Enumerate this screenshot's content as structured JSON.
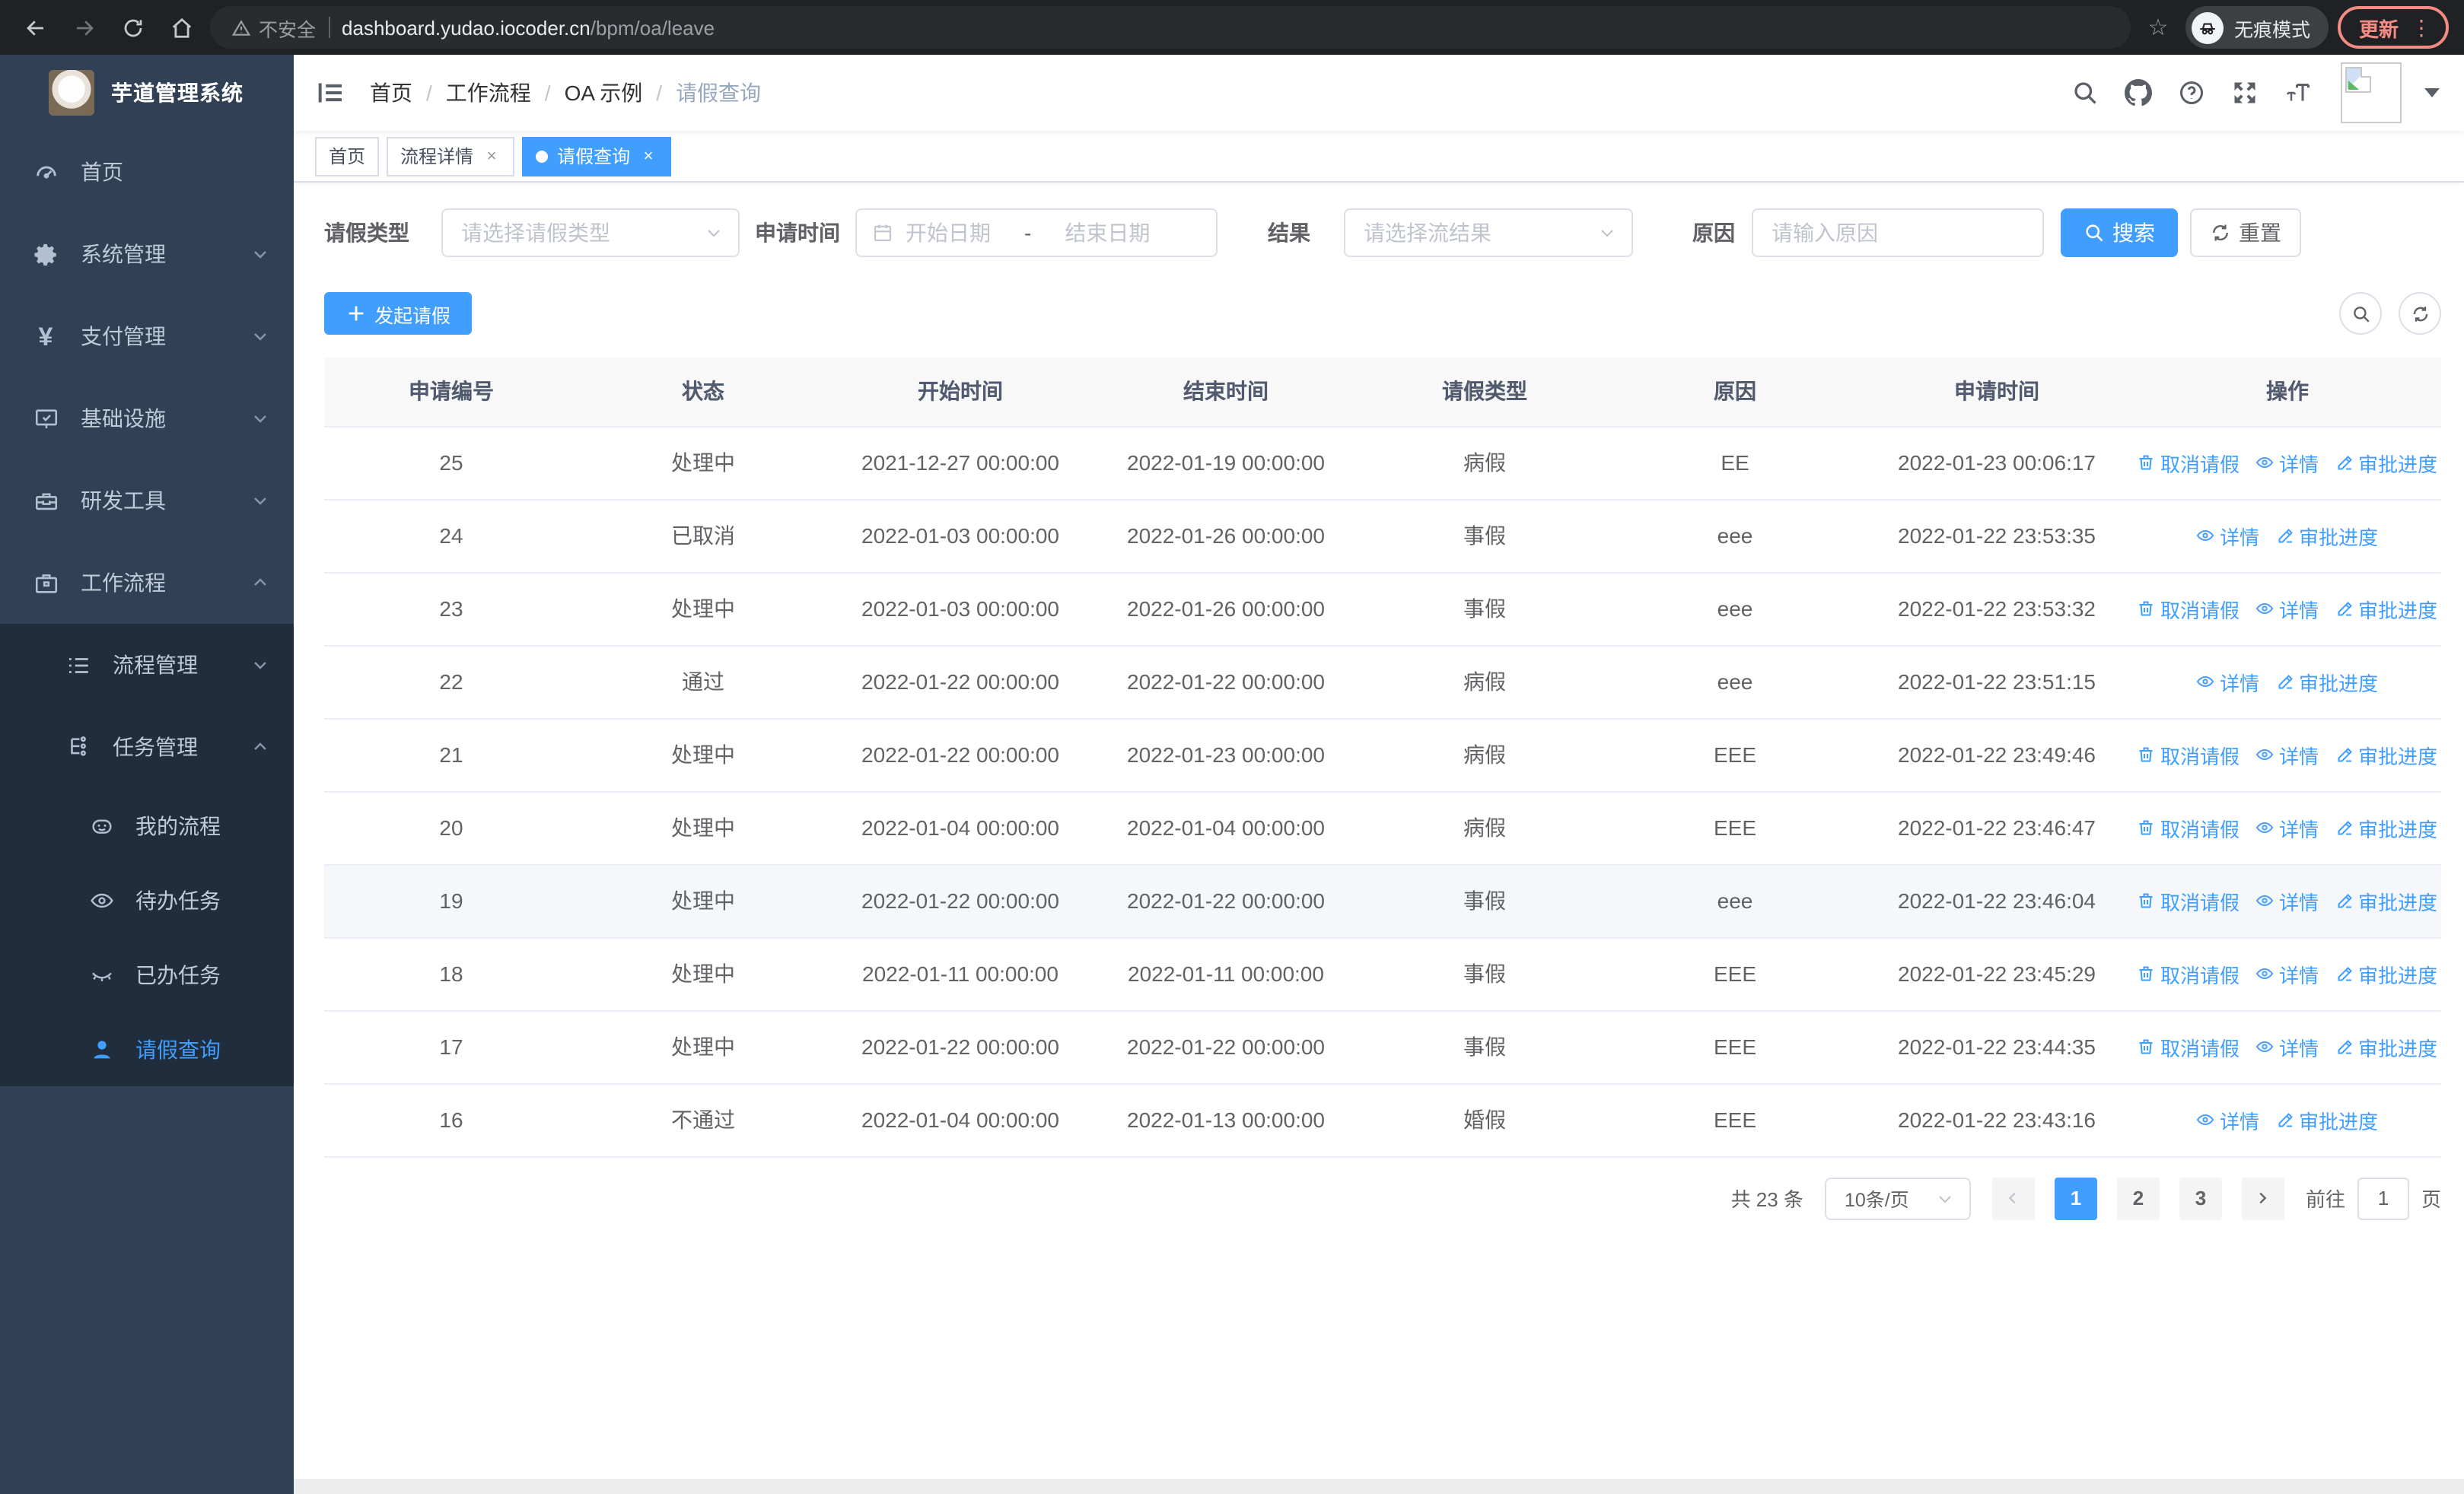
{
  "browser": {
    "security_label": "不安全",
    "url_host": "dashboard.yudao.iocoder.cn",
    "url_path": "/bpm/oa/leave",
    "incognito_label": "无痕模式",
    "update_label": "更新"
  },
  "sidebar": {
    "title": "芋道管理系统",
    "menu": [
      {
        "label": "首页"
      },
      {
        "label": "系统管理"
      },
      {
        "label": "支付管理"
      },
      {
        "label": "基础设施"
      },
      {
        "label": "研发工具"
      },
      {
        "label": "工作流程"
      }
    ],
    "submenu": [
      {
        "label": "流程管理"
      },
      {
        "label": "任务管理"
      }
    ],
    "task_items": [
      {
        "label": "我的流程"
      },
      {
        "label": "待办任务"
      },
      {
        "label": "已办任务"
      },
      {
        "label": "请假查询",
        "active": true
      }
    ],
    "yen_glyph": "¥"
  },
  "header": {
    "breadcrumb": [
      "首页",
      "工作流程",
      "OA 示例",
      "请假查询"
    ],
    "separator": "/"
  },
  "tabs": [
    {
      "label": "首页"
    },
    {
      "label": "流程详情"
    },
    {
      "label": "请假查询"
    }
  ],
  "filters": {
    "leave_type_label": "请假类型",
    "leave_type_placeholder": "请选择请假类型",
    "apply_time_label": "申请时间",
    "start_date_placeholder": "开始日期",
    "range_separator": "-",
    "end_date_placeholder": "结束日期",
    "result_label": "结果",
    "result_placeholder": "请选择流结果",
    "reason_label": "原因",
    "reason_placeholder": "请输入原因",
    "search_label": "搜索",
    "reset_label": "重置"
  },
  "toolbar": {
    "create_label": "发起请假"
  },
  "table": {
    "columns": [
      "申请编号",
      "状态",
      "开始时间",
      "结束时间",
      "请假类型",
      "原因",
      "申请时间",
      "操作"
    ],
    "action_labels": {
      "cancel": "取消请假",
      "detail": "详情",
      "progress": "审批进度"
    },
    "rows": [
      {
        "id": "25",
        "status": "处理中",
        "start": "2021-12-27 00:00:00",
        "end": "2022-01-19 00:00:00",
        "type": "病假",
        "reason": "EE",
        "applied": "2022-01-23 00:06:17",
        "actions": [
          "cancel",
          "detail",
          "progress"
        ],
        "hover": false
      },
      {
        "id": "24",
        "status": "已取消",
        "start": "2022-01-03 00:00:00",
        "end": "2022-01-26 00:00:00",
        "type": "事假",
        "reason": "eee",
        "applied": "2022-01-22 23:53:35",
        "actions": [
          "detail",
          "progress"
        ],
        "hover": false
      },
      {
        "id": "23",
        "status": "处理中",
        "start": "2022-01-03 00:00:00",
        "end": "2022-01-26 00:00:00",
        "type": "事假",
        "reason": "eee",
        "applied": "2022-01-22 23:53:32",
        "actions": [
          "cancel",
          "detail",
          "progress"
        ],
        "hover": false
      },
      {
        "id": "22",
        "status": "通过",
        "start": "2022-01-22 00:00:00",
        "end": "2022-01-22 00:00:00",
        "type": "病假",
        "reason": "eee",
        "applied": "2022-01-22 23:51:15",
        "actions": [
          "detail",
          "progress"
        ],
        "hover": false
      },
      {
        "id": "21",
        "status": "处理中",
        "start": "2022-01-22 00:00:00",
        "end": "2022-01-23 00:00:00",
        "type": "病假",
        "reason": "EEE",
        "applied": "2022-01-22 23:49:46",
        "actions": [
          "cancel",
          "detail",
          "progress"
        ],
        "hover": false
      },
      {
        "id": "20",
        "status": "处理中",
        "start": "2022-01-04 00:00:00",
        "end": "2022-01-04 00:00:00",
        "type": "病假",
        "reason": "EEE",
        "applied": "2022-01-22 23:46:47",
        "actions": [
          "cancel",
          "detail",
          "progress"
        ],
        "hover": false
      },
      {
        "id": "19",
        "status": "处理中",
        "start": "2022-01-22 00:00:00",
        "end": "2022-01-22 00:00:00",
        "type": "事假",
        "reason": "eee",
        "applied": "2022-01-22 23:46:04",
        "actions": [
          "cancel",
          "detail",
          "progress"
        ],
        "hover": true
      },
      {
        "id": "18",
        "status": "处理中",
        "start": "2022-01-11 00:00:00",
        "end": "2022-01-11 00:00:00",
        "type": "事假",
        "reason": "EEE",
        "applied": "2022-01-22 23:45:29",
        "actions": [
          "cancel",
          "detail",
          "progress"
        ],
        "hover": false
      },
      {
        "id": "17",
        "status": "处理中",
        "start": "2022-01-22 00:00:00",
        "end": "2022-01-22 00:00:00",
        "type": "事假",
        "reason": "EEE",
        "applied": "2022-01-22 23:44:35",
        "actions": [
          "cancel",
          "detail",
          "progress"
        ],
        "hover": false
      },
      {
        "id": "16",
        "status": "不通过",
        "start": "2022-01-04 00:00:00",
        "end": "2022-01-13 00:00:00",
        "type": "婚假",
        "reason": "EEE",
        "applied": "2022-01-22 23:43:16",
        "actions": [
          "detail",
          "progress"
        ],
        "hover": false
      }
    ]
  },
  "pagination": {
    "total_label": "共 23 条",
    "page_size": "10条/页",
    "pages": [
      "1",
      "2",
      "3"
    ],
    "active_page": "1",
    "goto_label": "前往",
    "goto_value": "1",
    "unit_label": "页"
  },
  "colors": {
    "accent": "#409eff",
    "sidebar_bg": "#304156",
    "submenu_bg": "#1f2d3d",
    "update_accent": "#f28b82"
  }
}
